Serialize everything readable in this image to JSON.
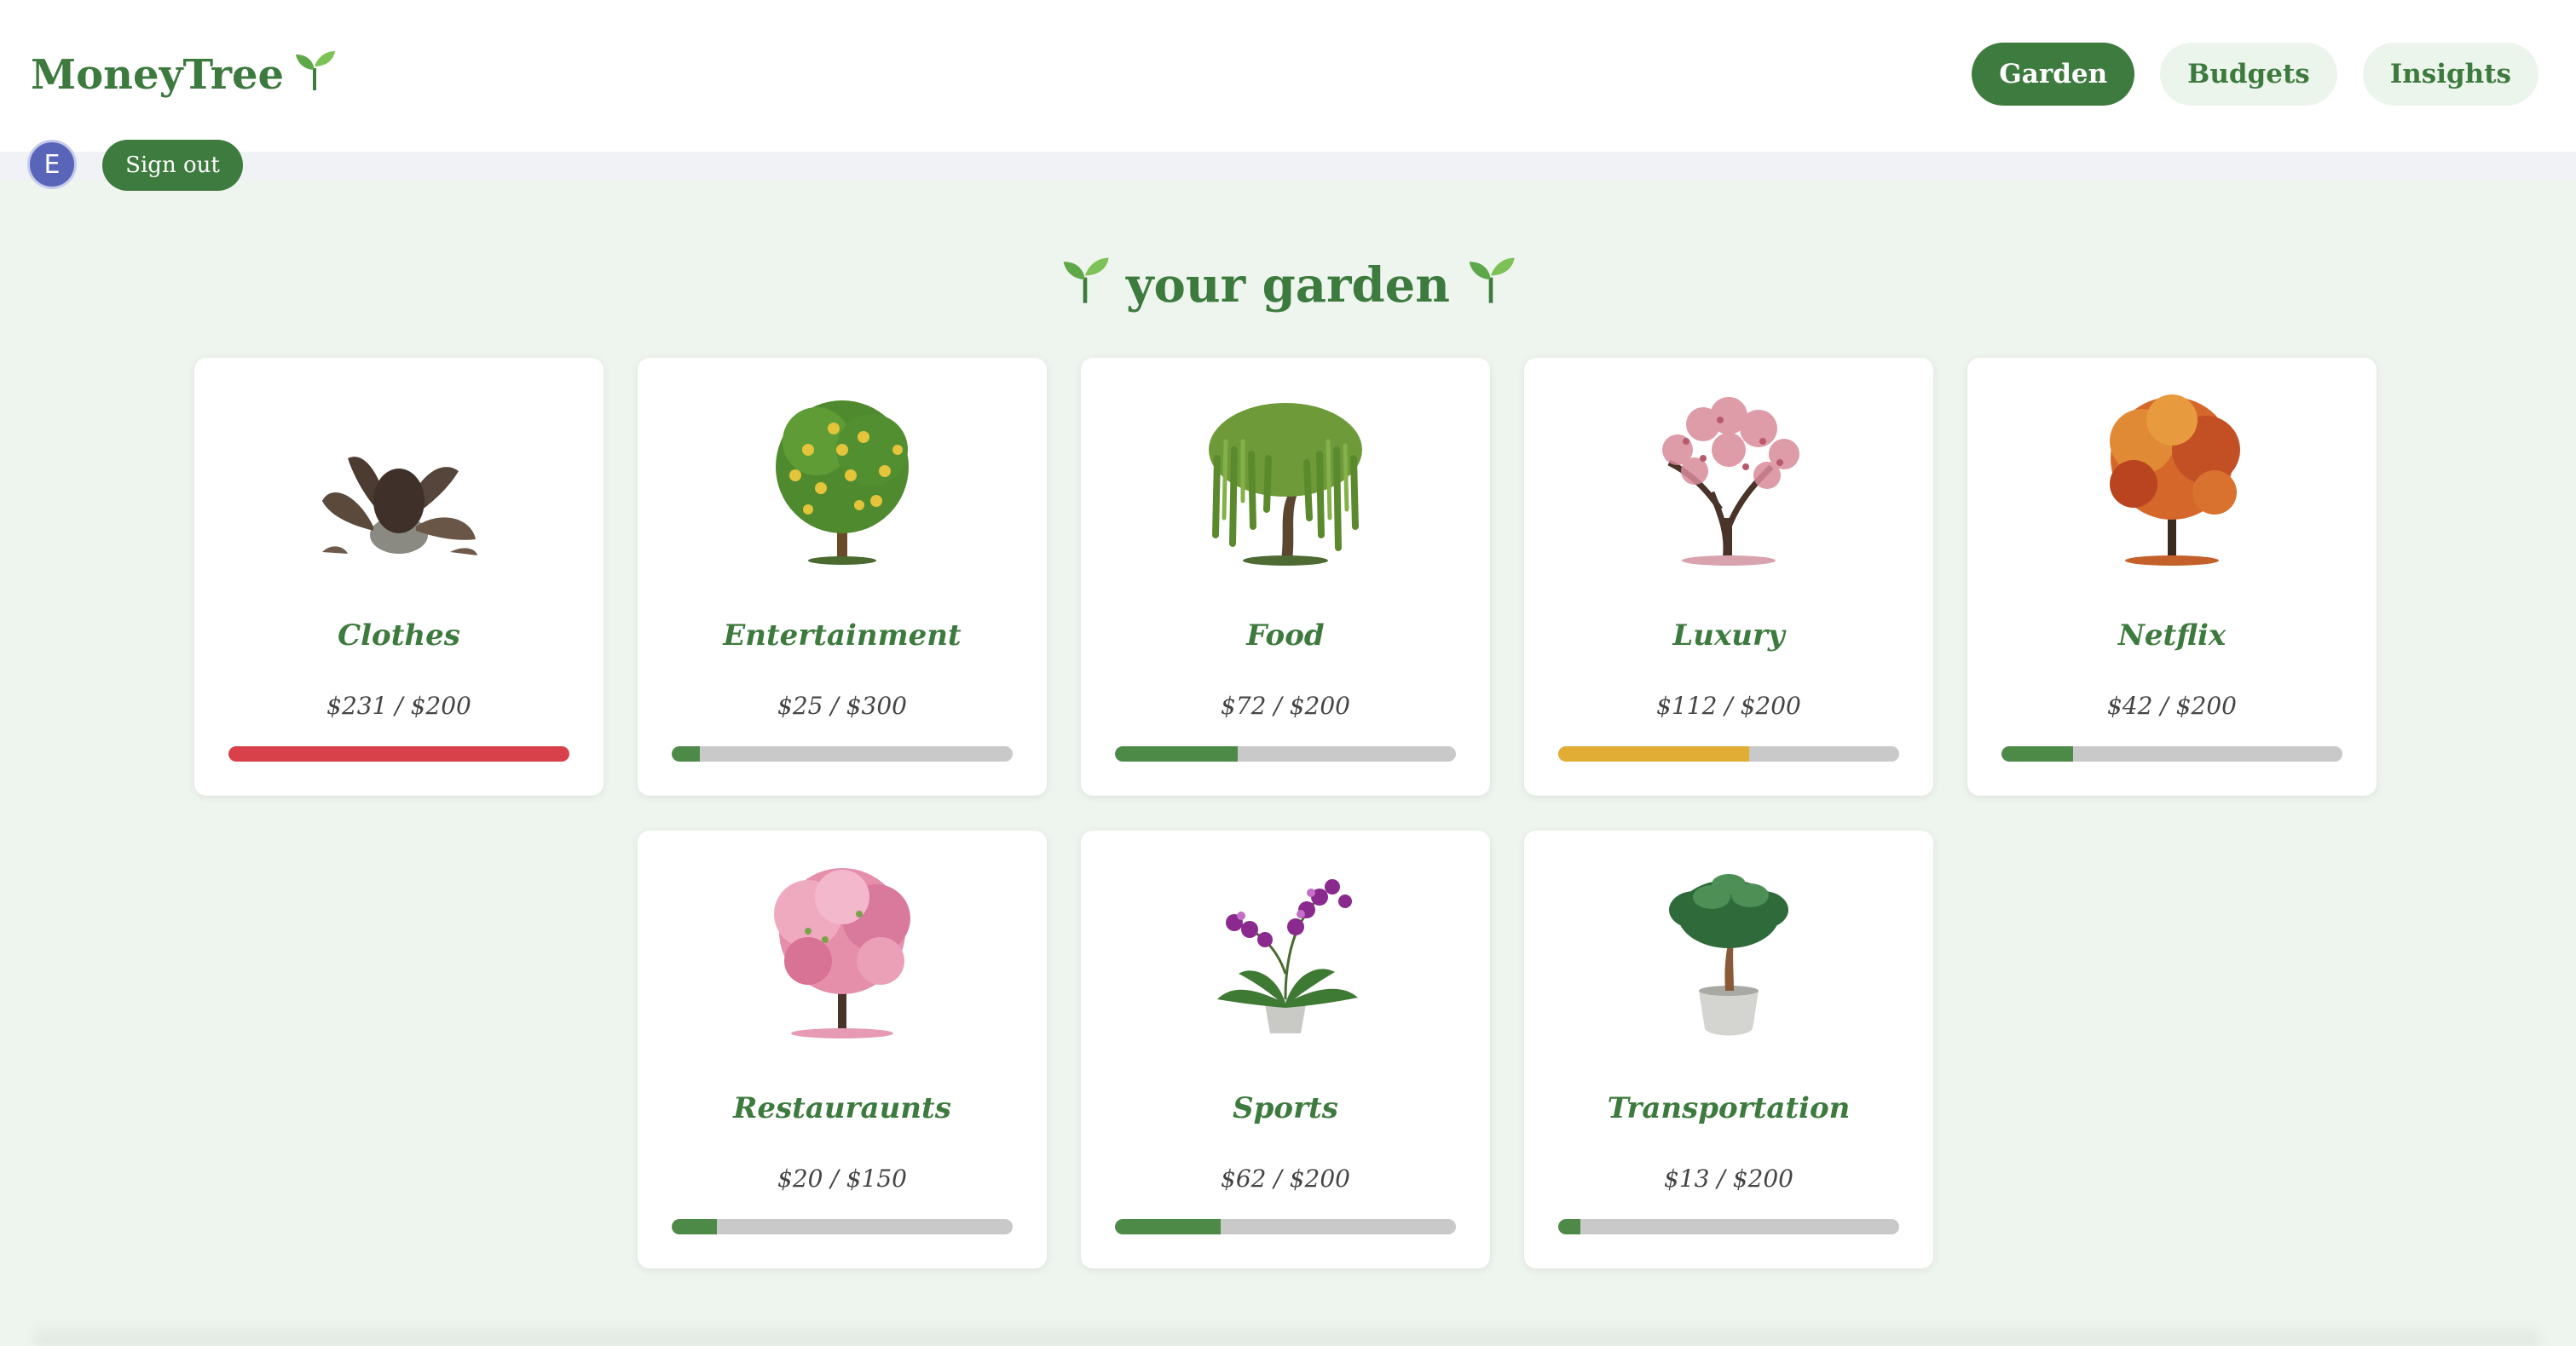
{
  "app": {
    "brand": "MoneyTree",
    "brand_icon": "sprout-icon"
  },
  "nav": {
    "garden": "Garden",
    "budgets": "Budgets",
    "insights": "Insights",
    "active": "Garden"
  },
  "user": {
    "avatar_initial": "E",
    "signout_label": "Sign out"
  },
  "page": {
    "title": "your garden"
  },
  "colors": {
    "brand_green": "#3d7a3e",
    "over_budget": "#d9414a",
    "warning": "#e2ad34",
    "ok": "#4d8a48",
    "track": "#c9c9c9"
  },
  "budgets": [
    {
      "name": "Clothes",
      "amount": "$231 / $200",
      "progress": 1.0,
      "status": "over",
      "plant": "wilted-plant-icon"
    },
    {
      "name": "Entertainment",
      "amount": "$25 / $300",
      "progress": 0.083,
      "status": "ok",
      "plant": "lemon-tree-icon"
    },
    {
      "name": "Food",
      "amount": "$72 / $200",
      "progress": 0.36,
      "status": "ok",
      "plant": "willow-tree-icon"
    },
    {
      "name": "Luxury",
      "amount": "$112 / $200",
      "progress": 0.56,
      "status": "warning",
      "plant": "blossom-tree-icon"
    },
    {
      "name": "Netflix",
      "amount": "$42 / $200",
      "progress": 0.21,
      "status": "ok",
      "plant": "maple-tree-icon"
    },
    {
      "name": "Restauraunts",
      "amount": "$20 / $150",
      "progress": 0.133,
      "status": "ok",
      "plant": "cherry-blossom-tree-icon"
    },
    {
      "name": "Sports",
      "amount": "$62 / $200",
      "progress": 0.31,
      "status": "ok",
      "plant": "orchid-icon"
    },
    {
      "name": "Transportation",
      "amount": "$13 / $200",
      "progress": 0.065,
      "status": "ok",
      "plant": "potted-tree-icon"
    }
  ]
}
